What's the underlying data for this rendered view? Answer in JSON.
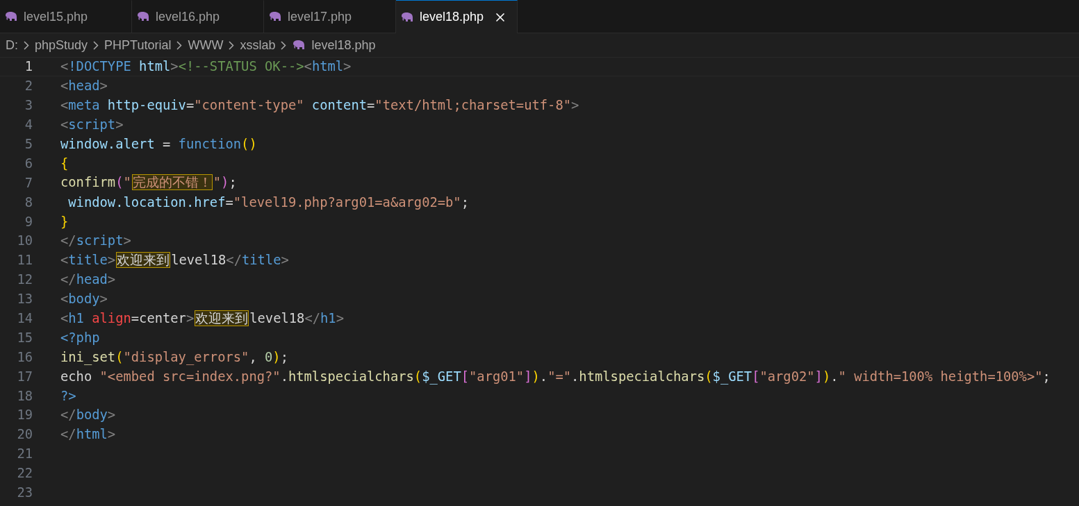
{
  "tabs": [
    {
      "label": "level15.php",
      "selected": false
    },
    {
      "label": "level16.php",
      "selected": false
    },
    {
      "label": "level17.php",
      "selected": false
    },
    {
      "label": "level18.php",
      "selected": true
    }
  ],
  "breadcrumb": [
    {
      "label": "D:",
      "kind": "folder"
    },
    {
      "label": "phpStudy",
      "kind": "folder"
    },
    {
      "label": "PHPTutorial",
      "kind": "folder"
    },
    {
      "label": "WWW",
      "kind": "folder"
    },
    {
      "label": "xsslab",
      "kind": "folder"
    },
    {
      "label": "level18.php",
      "kind": "file"
    }
  ],
  "lines": [
    {
      "number": "1",
      "selected": true,
      "tokens": [
        {
          "text": "<",
          "kind": "punct"
        },
        {
          "text": "!DOCTYPE",
          "kind": "tag"
        },
        {
          "text": " html",
          "kind": "attr"
        },
        {
          "text": ">",
          "kind": "punct"
        },
        {
          "text": "<!--STATUS OK-->",
          "kind": "comment"
        },
        {
          "text": "<",
          "kind": "punct"
        },
        {
          "text": "html",
          "kind": "tag"
        },
        {
          "text": ">",
          "kind": "punct"
        }
      ]
    },
    {
      "number": "2",
      "selected": false,
      "tokens": [
        {
          "text": "<",
          "kind": "punct"
        },
        {
          "text": "head",
          "kind": "tag"
        },
        {
          "text": ">",
          "kind": "punct"
        }
      ]
    },
    {
      "number": "3",
      "selected": false,
      "tokens": [
        {
          "text": "<",
          "kind": "punct"
        },
        {
          "text": "meta",
          "kind": "tag"
        },
        {
          "text": " http-equiv",
          "kind": "attr"
        },
        {
          "text": "=",
          "kind": "plain"
        },
        {
          "text": "\"content-type\"",
          "kind": "string"
        },
        {
          "text": " content",
          "kind": "attr"
        },
        {
          "text": "=",
          "kind": "plain"
        },
        {
          "text": "\"text/html;charset=utf-8\"",
          "kind": "string"
        },
        {
          "text": ">",
          "kind": "punct"
        }
      ]
    },
    {
      "number": "4",
      "selected": false,
      "tokens": [
        {
          "text": "<",
          "kind": "punct"
        },
        {
          "text": "script",
          "kind": "tag"
        },
        {
          "text": ">",
          "kind": "punct"
        }
      ]
    },
    {
      "number": "5",
      "selected": false,
      "tokens": [
        {
          "text": "window.alert",
          "kind": "attr"
        },
        {
          "text": " = ",
          "kind": "plain"
        },
        {
          "text": "function",
          "kind": "tag"
        },
        {
          "text": "()",
          "kind": "brace"
        }
      ]
    },
    {
      "number": "6",
      "selected": false,
      "tokens": [
        {
          "text": "{",
          "kind": "brace"
        }
      ]
    },
    {
      "number": "7",
      "selected": false,
      "tokens": [
        {
          "text": "confirm",
          "kind": "func"
        },
        {
          "text": "(",
          "kind": "bracket"
        },
        {
          "text": "\"",
          "kind": "string"
        },
        {
          "text": "完成的不错！",
          "kind": "string_boxed"
        },
        {
          "text": "\"",
          "kind": "string"
        },
        {
          "text": ")",
          "kind": "bracket"
        },
        {
          "text": ";",
          "kind": "plain"
        }
      ]
    },
    {
      "number": "8",
      "selected": false,
      "tokens": [
        {
          "text": " window.location.href",
          "kind": "attr"
        },
        {
          "text": "=",
          "kind": "plain"
        },
        {
          "text": "\"level19.php?arg01=a&arg02=b\"",
          "kind": "string"
        },
        {
          "text": ";",
          "kind": "plain"
        }
      ]
    },
    {
      "number": "9",
      "selected": false,
      "tokens": [
        {
          "text": "}",
          "kind": "brace"
        }
      ]
    },
    {
      "number": "10",
      "selected": false,
      "tokens": [
        {
          "text": "</",
          "kind": "punct"
        },
        {
          "text": "script",
          "kind": "tag"
        },
        {
          "text": ">",
          "kind": "punct"
        }
      ]
    },
    {
      "number": "11",
      "selected": false,
      "tokens": [
        {
          "text": "<",
          "kind": "punct"
        },
        {
          "text": "title",
          "kind": "tag"
        },
        {
          "text": ">",
          "kind": "punct"
        },
        {
          "text": "欢迎来到",
          "kind": "plain_boxed"
        },
        {
          "text": "level18",
          "kind": "plain"
        },
        {
          "text": "</",
          "kind": "punct"
        },
        {
          "text": "title",
          "kind": "tag"
        },
        {
          "text": ">",
          "kind": "punct"
        }
      ]
    },
    {
      "number": "12",
      "selected": false,
      "tokens": [
        {
          "text": "</",
          "kind": "punct"
        },
        {
          "text": "head",
          "kind": "tag"
        },
        {
          "text": ">",
          "kind": "punct"
        }
      ]
    },
    {
      "number": "13",
      "selected": false,
      "tokens": [
        {
          "text": "<",
          "kind": "punct"
        },
        {
          "text": "body",
          "kind": "tag"
        },
        {
          "text": ">",
          "kind": "punct"
        }
      ]
    },
    {
      "number": "14",
      "selected": false,
      "tokens": [
        {
          "text": "<",
          "kind": "punct"
        },
        {
          "text": "h1",
          "kind": "tag"
        },
        {
          "text": " align",
          "kind": "invalid"
        },
        {
          "text": "=center",
          "kind": "plain"
        },
        {
          "text": ">",
          "kind": "punct"
        },
        {
          "text": "欢迎来到",
          "kind": "plain_boxed"
        },
        {
          "text": "level18",
          "kind": "plain"
        },
        {
          "text": "</",
          "kind": "punct"
        },
        {
          "text": "h1",
          "kind": "tag"
        },
        {
          "text": ">",
          "kind": "punct"
        }
      ]
    },
    {
      "number": "15",
      "selected": false,
      "tokens": [
        {
          "text": "<?php",
          "kind": "tag"
        }
      ]
    },
    {
      "number": "16",
      "selected": false,
      "tokens": [
        {
          "text": "ini_set",
          "kind": "func"
        },
        {
          "text": "(",
          "kind": "brace"
        },
        {
          "text": "\"display_errors\"",
          "kind": "string"
        },
        {
          "text": ", ",
          "kind": "plain"
        },
        {
          "text": "0",
          "kind": "number"
        },
        {
          "text": ")",
          "kind": "brace"
        },
        {
          "text": ";",
          "kind": "plain"
        }
      ]
    },
    {
      "number": "17",
      "selected": false,
      "tokens": [
        {
          "text": "echo ",
          "kind": "plain"
        },
        {
          "text": "\"<embed src=index.png?\"",
          "kind": "string"
        },
        {
          "text": ".",
          "kind": "plain"
        },
        {
          "text": "htmlspecialchars",
          "kind": "func"
        },
        {
          "text": "(",
          "kind": "brace"
        },
        {
          "text": "$_GET",
          "kind": "attr"
        },
        {
          "text": "[",
          "kind": "bracket"
        },
        {
          "text": "\"arg01\"",
          "kind": "string"
        },
        {
          "text": "]",
          "kind": "bracket"
        },
        {
          "text": ")",
          "kind": "brace"
        },
        {
          "text": ".",
          "kind": "plain"
        },
        {
          "text": "\"=\"",
          "kind": "string"
        },
        {
          "text": ".",
          "kind": "plain"
        },
        {
          "text": "htmlspecialchars",
          "kind": "func"
        },
        {
          "text": "(",
          "kind": "brace"
        },
        {
          "text": "$_GET",
          "kind": "attr"
        },
        {
          "text": "[",
          "kind": "bracket"
        },
        {
          "text": "\"arg02\"",
          "kind": "string"
        },
        {
          "text": "]",
          "kind": "bracket"
        },
        {
          "text": ")",
          "kind": "brace"
        },
        {
          "text": ".",
          "kind": "plain"
        },
        {
          "text": "\" width=100% heigth=100%>\"",
          "kind": "string"
        },
        {
          "text": ";",
          "kind": "plain"
        }
      ]
    },
    {
      "number": "18",
      "selected": false,
      "tokens": [
        {
          "text": "?>",
          "kind": "tag"
        }
      ]
    },
    {
      "number": "19",
      "selected": false,
      "tokens": [
        {
          "text": "</",
          "kind": "punct"
        },
        {
          "text": "body",
          "kind": "tag"
        },
        {
          "text": ">",
          "kind": "punct"
        }
      ]
    },
    {
      "number": "20",
      "selected": false,
      "tokens": [
        {
          "text": "</",
          "kind": "punct"
        },
        {
          "text": "html",
          "kind": "tag"
        },
        {
          "text": ">",
          "kind": "punct"
        }
      ]
    },
    {
      "number": "21",
      "selected": false
    },
    {
      "number": "22",
      "selected": false
    },
    {
      "number": "23",
      "selected": false
    }
  ]
}
